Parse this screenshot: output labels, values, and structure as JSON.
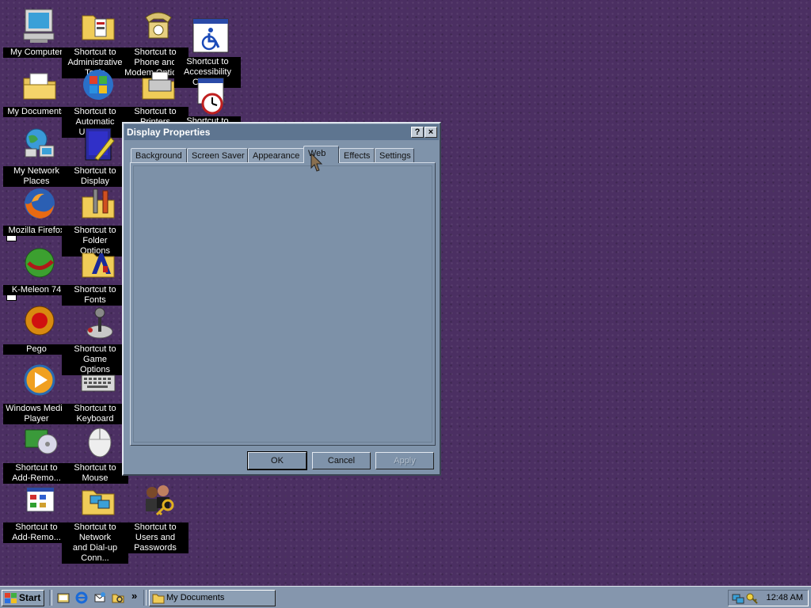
{
  "desktop": {
    "icons": [
      {
        "label": "My Computer"
      },
      {
        "label": "Shortcut to\nAdministrative Tools"
      },
      {
        "label": "Shortcut to Phone and\nModem Options"
      },
      {
        "label": "Shortcut to\nAccessibility Options"
      },
      {
        "label": "My Documents"
      },
      {
        "label": "Shortcut to Automatic\nUpdates"
      },
      {
        "label": "Shortcut to Printers"
      },
      {
        "label": "Shortcut to"
      },
      {
        "label": "My Network Places"
      },
      {
        "label": "Shortcut to Display"
      },
      {
        "label": "Mozilla Firefox"
      },
      {
        "label": "Shortcut to Folder\nOptions"
      },
      {
        "label": "K-Meleon 74"
      },
      {
        "label": "Shortcut to Fonts"
      },
      {
        "label": "Pego"
      },
      {
        "label": "Shortcut to Game\nOptions"
      },
      {
        "label": "Windows Media\nPlayer"
      },
      {
        "label": "Shortcut to Keyboard"
      },
      {
        "label": "Shortcut to\nAdd-Remo..."
      },
      {
        "label": "Shortcut to Mouse"
      },
      {
        "label": "Shortcut to\nAdd-Remo..."
      },
      {
        "label": "Shortcut to Network\nand Dial-up Conn..."
      },
      {
        "label": "Shortcut to Users and\nPasswords"
      }
    ]
  },
  "dialog": {
    "title": "Display Properties",
    "help_glyph": "?",
    "close_glyph": "×",
    "tabs": [
      {
        "label": "Background"
      },
      {
        "label": "Screen Saver"
      },
      {
        "label": "Appearance"
      },
      {
        "label": "Web",
        "active": true
      },
      {
        "label": "Effects"
      },
      {
        "label": "Settings"
      }
    ],
    "buttons": {
      "ok": "OK",
      "cancel": "Cancel",
      "apply": "Apply"
    }
  },
  "taskbar": {
    "start_label": "Start",
    "chevron": "»",
    "task_label": "My Documents",
    "clock": "12:48 AM"
  },
  "colors": {
    "desktop": "#4b2f62",
    "dialog_face": "#7f93aa",
    "titlebar": "#5e7590",
    "taskbar": "#8596ad"
  }
}
